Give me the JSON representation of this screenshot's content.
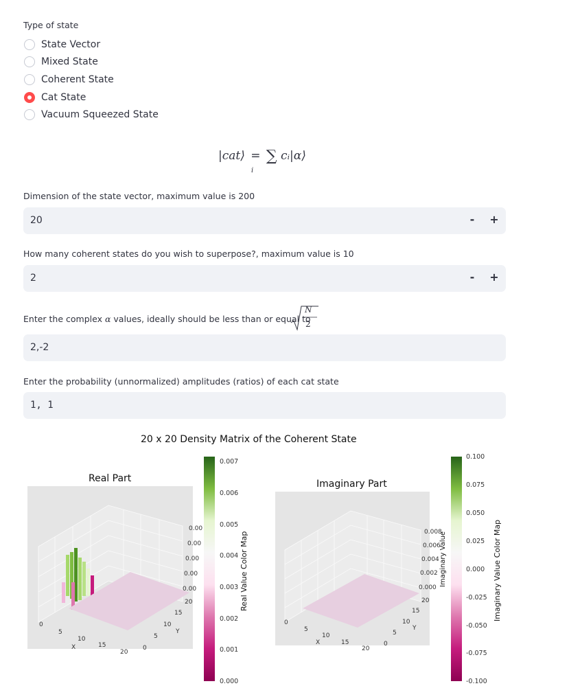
{
  "state_type": {
    "label": "Type of state",
    "options": [
      "State Vector",
      "Mixed State",
      "Coherent State",
      "Cat State",
      "Vacuum Squeezed State"
    ],
    "selected": "Cat State"
  },
  "formula": {
    "lhs": "|cat⟩",
    "eq": "=",
    "sigma": "∑",
    "sub": "i",
    "rhs": "cᵢ|α⟩"
  },
  "dimension": {
    "label": "Dimension of the state vector, maximum value is 200",
    "value": "20",
    "minus": "-",
    "plus": "+"
  },
  "superpose": {
    "label": "How many coherent states do you wish to superpose?, maximum value is 10",
    "value": "2",
    "minus": "-",
    "plus": "+"
  },
  "alpha": {
    "label_prefix": "Enter the complex",
    "label_alpha": "α",
    "label_suffix": "values, ideally should be less than or equal to",
    "sqrt_num": "N",
    "sqrt_den": "2",
    "value": "2,-2"
  },
  "amplitudes": {
    "label": "Enter the probability (unnormalized) amplitudes (ratios) of each cat state",
    "value": "1, 1"
  },
  "figure": {
    "title": "20 x 20 Density Matrix of the Coherent State",
    "real_title": "Real Part",
    "imag_title": "Imaginary Part",
    "real_cbar_label": "Real Value Color Map",
    "imag_cbar_label": "Imaginary Value Color Map",
    "real_x_label": "X",
    "real_y_label": "Y",
    "imag_x_label": "X",
    "imag_y_label": "Y",
    "imag_z_label": "Imaginary Value",
    "real_x_ticks": [
      "0",
      "5",
      "10",
      "15",
      "20"
    ],
    "real_y_ticks": [
      "0",
      "5",
      "10",
      "15",
      "20"
    ],
    "real_z_ticks": [
      "0.00",
      "0.00",
      "0.00",
      "0.00",
      "0.00"
    ],
    "imag_x_ticks": [
      "0",
      "5",
      "10",
      "15",
      "20"
    ],
    "imag_y_ticks": [
      "0",
      "5",
      "10",
      "15",
      "20"
    ],
    "imag_z_ticks": [
      "0.008",
      "0.006",
      "0.004",
      "0.002",
      "0.000"
    ],
    "real_cbar_ticks": [
      "0.007",
      "0.006",
      "0.005",
      "0.004",
      "0.003",
      "0.002",
      "0.001",
      "0.000"
    ],
    "imag_cbar_ticks": [
      "0.100",
      "0.075",
      "0.050",
      "0.025",
      "0.000",
      "-0.025",
      "-0.050",
      "-0.075",
      "-0.100"
    ],
    "colors": {
      "cbar_top": "#276419",
      "cbar_mid": "#f7f7f7",
      "cbar_bottom": "#c51b7d",
      "accent": "#ff4b4b"
    }
  }
}
